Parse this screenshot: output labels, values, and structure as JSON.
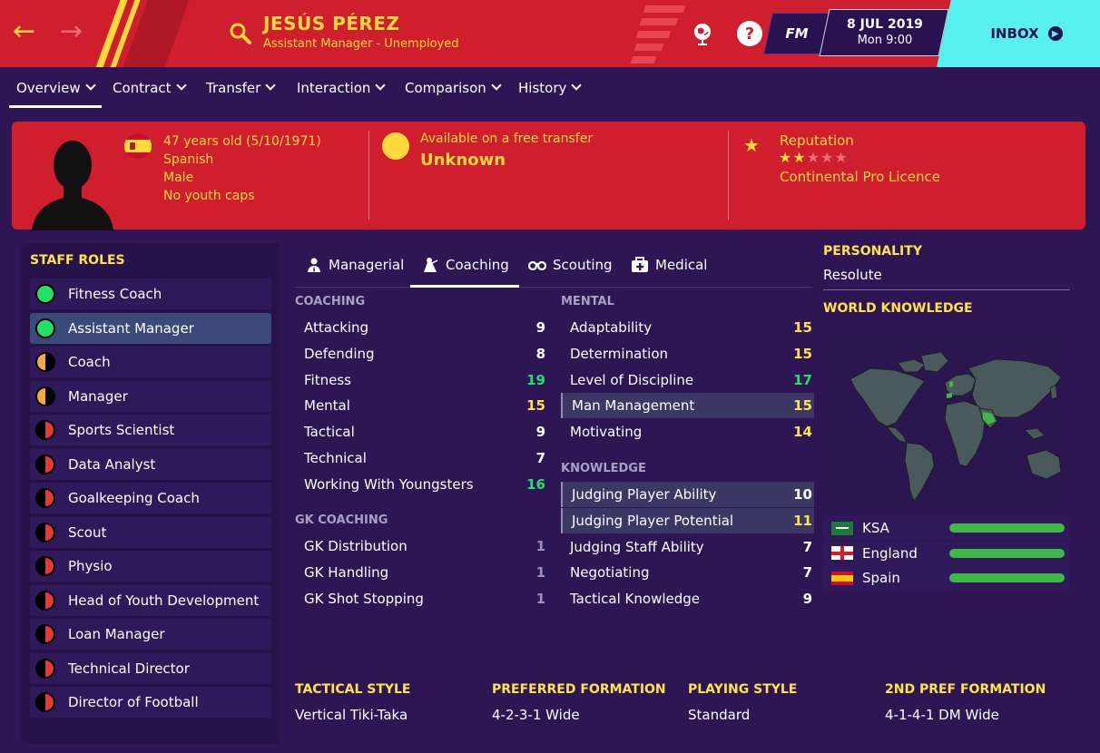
{
  "header": {
    "name": "JESÚS PÉREZ",
    "subtitle": "Assistant Manager - Unemployed",
    "fm_label": "FM",
    "date": "8 JUL 2019",
    "time": "Mon 9:00",
    "inbox_label": "INBOX",
    "help_label": "?"
  },
  "tabs": [
    "Overview",
    "Contract",
    "Transfer",
    "Interaction",
    "Comparison",
    "History"
  ],
  "profile": {
    "age": "47 years old (5/10/1971)",
    "nationality": "Spanish",
    "gender": "Male",
    "caps": "No youth caps",
    "availability_label": "Available on a free transfer",
    "availability_value": "Unknown",
    "reputation_label": "Reputation",
    "reputation_stars": 2,
    "reputation_max": 5,
    "licence": "Continental Pro Licence"
  },
  "staff_roles": {
    "title": "STAFF ROLES",
    "items": [
      {
        "label": "Fitness Coach",
        "status": "green"
      },
      {
        "label": "Assistant Manager",
        "status": "green",
        "selected": true
      },
      {
        "label": "Coach",
        "status": "half"
      },
      {
        "label": "Manager",
        "status": "half"
      },
      {
        "label": "Sports Scientist",
        "status": "red"
      },
      {
        "label": "Data Analyst",
        "status": "red"
      },
      {
        "label": "Goalkeeping Coach",
        "status": "red"
      },
      {
        "label": "Scout",
        "status": "red"
      },
      {
        "label": "Physio",
        "status": "red"
      },
      {
        "label": "Head of Youth Development",
        "status": "red"
      },
      {
        "label": "Loan Manager",
        "status": "red"
      },
      {
        "label": "Technical Director",
        "status": "red"
      },
      {
        "label": "Director of Football",
        "status": "red"
      }
    ]
  },
  "attr_tabs": [
    "Managerial",
    "Coaching",
    "Scouting",
    "Medical"
  ],
  "coaching": {
    "title": "COACHING",
    "items": [
      {
        "name": "Attacking",
        "value": "9",
        "tier": "white"
      },
      {
        "name": "Defending",
        "value": "8",
        "tier": "white"
      },
      {
        "name": "Fitness",
        "value": "19",
        "tier": "green"
      },
      {
        "name": "Mental",
        "value": "15",
        "tier": "yellow"
      },
      {
        "name": "Tactical",
        "value": "9",
        "tier": "white"
      },
      {
        "name": "Technical",
        "value": "7",
        "tier": "white"
      },
      {
        "name": "Working With Youngsters",
        "value": "16",
        "tier": "green"
      }
    ]
  },
  "gk_coaching": {
    "title": "GK COACHING",
    "items": [
      {
        "name": "GK Distribution",
        "value": "1",
        "tier": "grey"
      },
      {
        "name": "GK Handling",
        "value": "1",
        "tier": "grey"
      },
      {
        "name": "GK Shot Stopping",
        "value": "1",
        "tier": "grey"
      }
    ]
  },
  "mental": {
    "title": "MENTAL",
    "items": [
      {
        "name": "Adaptability",
        "value": "15",
        "tier": "yellow"
      },
      {
        "name": "Determination",
        "value": "15",
        "tier": "yellow"
      },
      {
        "name": "Level of Discipline",
        "value": "17",
        "tier": "green"
      },
      {
        "name": "Man Management",
        "value": "15",
        "tier": "yellow",
        "hl": true
      },
      {
        "name": "Motivating",
        "value": "14",
        "tier": "yellow"
      }
    ]
  },
  "knowledge": {
    "title": "KNOWLEDGE",
    "items": [
      {
        "name": "Judging Player Ability",
        "value": "10",
        "tier": "white",
        "hl": true
      },
      {
        "name": "Judging Player Potential",
        "value": "11",
        "tier": "yellow",
        "hl": true
      },
      {
        "name": "Judging Staff Ability",
        "value": "7",
        "tier": "white"
      },
      {
        "name": "Negotiating",
        "value": "7",
        "tier": "white"
      },
      {
        "name": "Tactical Knowledge",
        "value": "9",
        "tier": "white"
      }
    ]
  },
  "personality": {
    "title": "PERSONALITY",
    "value": "Resolute"
  },
  "world_knowledge": {
    "title": "WORLD KNOWLEDGE",
    "nations": [
      {
        "name": "KSA",
        "flag": "ksa",
        "level": 1.0
      },
      {
        "name": "England",
        "flag": "england",
        "level": 1.0
      },
      {
        "name": "Spain",
        "flag": "spain",
        "level": 1.0
      }
    ]
  },
  "bottom": [
    {
      "title": "TACTICAL STYLE",
      "value": "Vertical Tiki-Taka"
    },
    {
      "title": "PREFERRED FORMATION",
      "value": "4-2-3-1 Wide"
    },
    {
      "title": "PLAYING STYLE",
      "value": "Standard"
    },
    {
      "title": "2ND PREF FORMATION",
      "value": "4-1-4-1 DM Wide"
    }
  ],
  "colors": {
    "accent_red": "#cf1f2e",
    "accent_yellow": "#ffd93b",
    "bg_purple": "#2e1654",
    "inbox_cyan": "#56f0ef",
    "rating_green": "#22e06a",
    "rating_yellow": "#ffe34a"
  }
}
